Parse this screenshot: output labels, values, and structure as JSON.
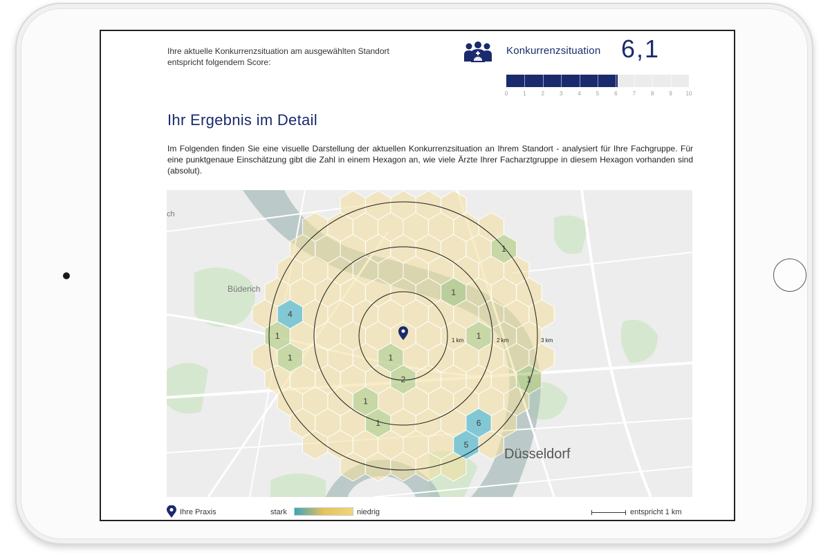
{
  "intro_text": "Ihre aktuelle Konkurrenzsituation am ausgewählten Standort entspricht folgendem Score:",
  "score": {
    "label": "Konkurrenzsituation",
    "value_text": "6,1",
    "value": 6.1,
    "max": 10,
    "scale_ticks": [
      "0",
      "1",
      "2",
      "3",
      "4",
      "5",
      "6",
      "7",
      "8",
      "9",
      "10"
    ]
  },
  "detail": {
    "heading": "Ihr Ergebnis im Detail",
    "description": "Im Folgenden finden Sie eine visuelle Darstellung der aktuellen Konkurrenzsituation an Ihrem Standort - analysiert für Ihre Fachgruppe. Für eine punktgenaue Einschätzung gibt die Zahl in einem Hexagon an, wie viele Ärzte Ihrer Facharztgruppe in diesem Hexagon vorhanden sind (absolut)."
  },
  "map": {
    "place_labels": [
      "Büderich",
      "Düsseldorf",
      "ch"
    ],
    "ring_labels": [
      "1 km",
      "2 km",
      "3 km"
    ],
    "hexagon_counts": [
      "4",
      "1",
      "1",
      "1",
      "1",
      "1",
      "1",
      "2",
      "1",
      "1",
      "1",
      "6",
      "5"
    ]
  },
  "legend": {
    "praxis": "Ihre Praxis",
    "stark": "stark",
    "niedrig": "niedrig",
    "scale_text": "entspricht 1 km"
  },
  "colors": {
    "brand_navy": "#1a2a6c",
    "hex_low": "#f2df9a",
    "hex_mid": "#b9cf8c",
    "hex_high": "#6fc1cf"
  },
  "icons": {
    "competition": "doctors-group-icon",
    "pin": "location-pin-icon"
  }
}
